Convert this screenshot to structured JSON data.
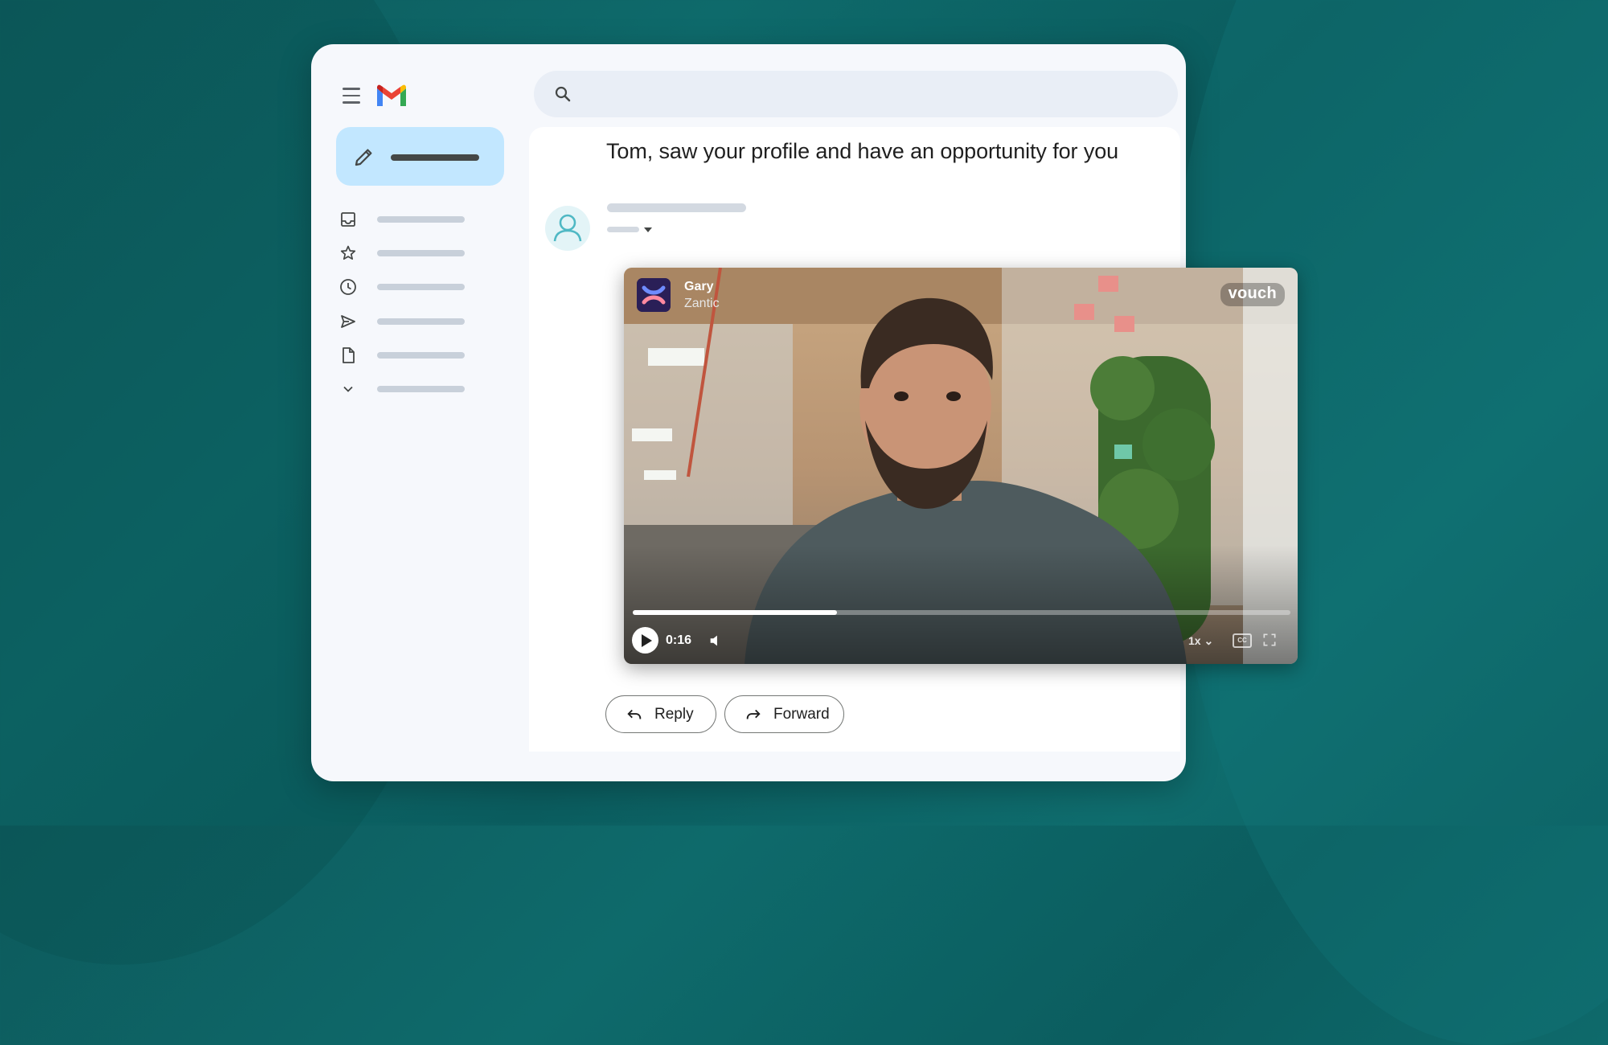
{
  "header": {
    "menu_icon": "hamburger-menu-icon",
    "logo": "gmail-logo",
    "search_icon": "search-icon"
  },
  "sidebar": {
    "compose_icon": "pencil-icon",
    "items": [
      {
        "icon": "inbox-icon"
      },
      {
        "icon": "star-icon"
      },
      {
        "icon": "clock-icon"
      },
      {
        "icon": "send-icon"
      },
      {
        "icon": "file-icon"
      },
      {
        "icon": "chevron-down-icon"
      }
    ]
  },
  "email": {
    "subject": "Tom, saw your profile and have an opportunity for you",
    "avatar_icon": "person-icon"
  },
  "video": {
    "sender_name": "Gary",
    "sender_company": "Zantic",
    "brand": "vouch",
    "time": "0:16",
    "progress": 0.31,
    "speed": "1x",
    "captions_label": "CC"
  },
  "actions": {
    "reply_label": "Reply",
    "forward_label": "Forward"
  },
  "colors": {
    "background": "#0e6a6b",
    "compose": "#c2e7ff",
    "search": "#e9eef6"
  }
}
